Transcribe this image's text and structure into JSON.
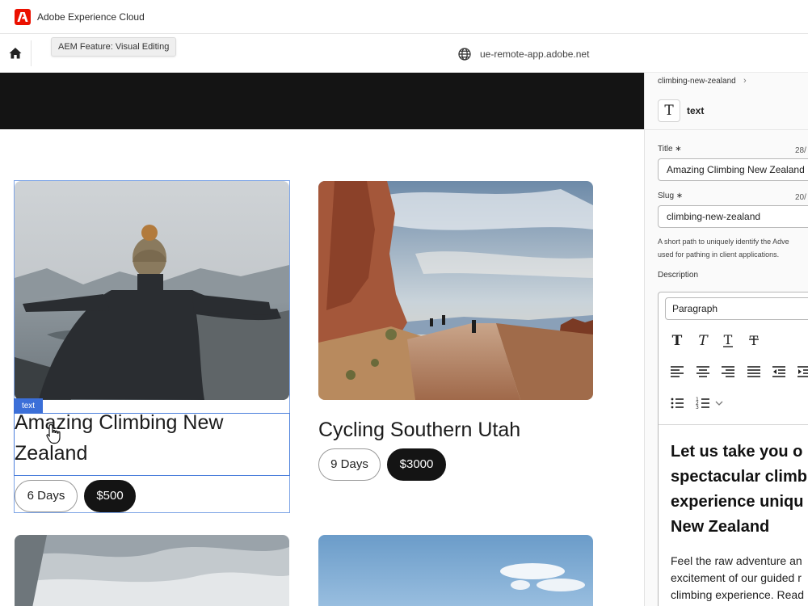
{
  "app": {
    "title": "Adobe Experience Cloud",
    "logo_icon": "adobe-logo-icon"
  },
  "subbar": {
    "home_icon": "home-icon",
    "tooltip": "AEM Feature: Visual Editing",
    "url": "ue-remote-app.adobe.net"
  },
  "colors": {
    "adobe_red": "#eb1000",
    "selection_blue": "#3b6fd8",
    "dark": "#141414"
  },
  "cards": [
    {
      "title_line1": "Amazing Climbing New",
      "title_line2": "Zealand",
      "duration": "6 Days",
      "price": "$500",
      "selected": true
    },
    {
      "title": "Cycling Southern Utah",
      "duration": "9 Days",
      "price": "$3000"
    }
  ],
  "selection": {
    "tag": "text"
  },
  "panel": {
    "breadcrumb": "climbing-new-zealand",
    "component_type": "text",
    "title_field": {
      "label": "Title ∗",
      "count": "28/",
      "value": "Amazing Climbing New Zealand"
    },
    "slug_field": {
      "label": "Slug ∗",
      "count": "20/",
      "value": "climbing-new-zealand"
    },
    "slug_help_line1": "A short path to uniquely identify the Adve",
    "slug_help_line2": "used for pathing in client applications.",
    "description_label": "Description",
    "rte": {
      "block_format": "Paragraph",
      "heading_lines": [
        "Let us take you o",
        "spectacular climb",
        "experience uniqu",
        "New Zealand"
      ],
      "body_lines": [
        "Feel the raw adventure an",
        "excitement of our guided r",
        "climbing experience. Read"
      ]
    }
  }
}
